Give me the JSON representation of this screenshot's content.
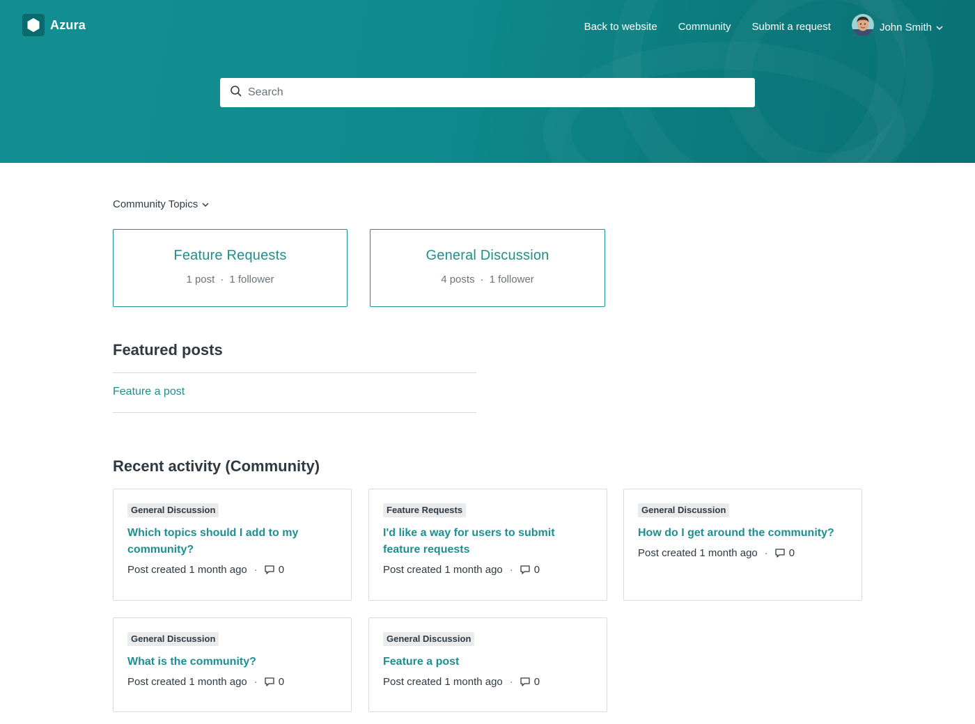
{
  "header": {
    "brand": "Azura",
    "nav": [
      "Back to website",
      "Community",
      "Submit a request"
    ],
    "user_name": "John Smith"
  },
  "search": {
    "placeholder": "Search"
  },
  "topics": {
    "dropdown_label": "Community Topics",
    "cards": [
      {
        "title": "Feature Requests",
        "posts": "1 post",
        "followers": "1 follower"
      },
      {
        "title": "General Discussion",
        "posts": "4 posts",
        "followers": "1 follower"
      }
    ]
  },
  "featured": {
    "heading": "Featured posts",
    "link": "Feature a post"
  },
  "recent": {
    "heading": "Recent activity (Community)",
    "posts": [
      {
        "topic": "General Discussion",
        "title": "Which topics should I add to my community?",
        "meta": "Post created 1 month ago",
        "comments": "0"
      },
      {
        "topic": "Feature Requests",
        "title": "I'd like a way for users to submit feature requests",
        "meta": "Post created 1 month ago",
        "comments": "0"
      },
      {
        "topic": "General Discussion",
        "title": "How do I get around the community?",
        "meta": "Post created 1 month ago",
        "comments": "0"
      },
      {
        "topic": "General Discussion",
        "title": "What is the community?",
        "meta": "Post created 1 month ago",
        "comments": "0"
      },
      {
        "topic": "General Discussion",
        "title": "Feature a post",
        "meta": "Post created 1 month ago",
        "comments": "0"
      }
    ]
  },
  "colors": {
    "brand_teal": "#0f8a8c",
    "link_teal": "#1f8e91",
    "text": "#2f3941",
    "muted": "#68737d",
    "border": "#d8dcde",
    "badge_bg": "#e9ebed"
  },
  "icons": [
    "hexagon-logo-icon",
    "search-icon",
    "chevron-down-icon",
    "comment-icon"
  ]
}
